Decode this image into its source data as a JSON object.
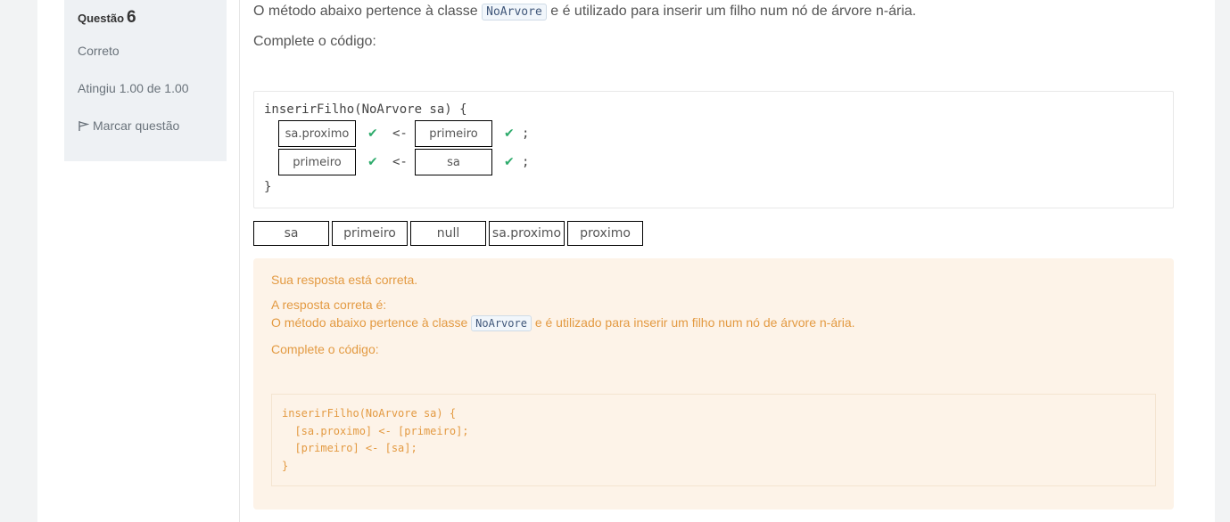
{
  "info": {
    "question_label": "Questão",
    "question_number": "6",
    "state": "Correto",
    "grade": "Atingiu 1.00 de 1.00",
    "flag_label": "Marcar questão"
  },
  "question": {
    "text_before": "O método abaixo pertence à classe",
    "class_name": "NoArvore",
    "text_after": "e é utilizado para inserir um filho num nó de árvore n-ária.",
    "prompt": "Complete o código:",
    "code_header": "inserirFilho(NoArvore sa) {",
    "code_footer": "}",
    "arrow": "<-",
    "semicolon": ";",
    "line1": {
      "left": "sa.proximo",
      "right": "primeiro"
    },
    "line2": {
      "left": "primeiro",
      "right": "sa"
    }
  },
  "choices": [
    "sa",
    "primeiro",
    "null",
    "sa.proximo",
    "proximo"
  ],
  "feedback": {
    "correct_msg": "Sua resposta está correta.",
    "answer_intro": "A resposta correta é:",
    "text_before": "O método abaixo pertence à classe",
    "class_name": "NoArvore",
    "text_after": "e é utilizado para inserir um filho num nó de árvore n-ária.",
    "prompt": "Complete o código:",
    "code": "inserirFilho(NoArvore sa) {\n  [sa.proximo] <- [primeiro];\n  [primeiro] <- [sa];\n}"
  },
  "colors": {
    "check": "#2eab6c",
    "feedback_bg": "#fdf3e8",
    "feedback_text": "#e39a42",
    "info_bg": "#eef1f4"
  },
  "icons": {
    "flag": "flag-icon",
    "check": "check-icon"
  }
}
